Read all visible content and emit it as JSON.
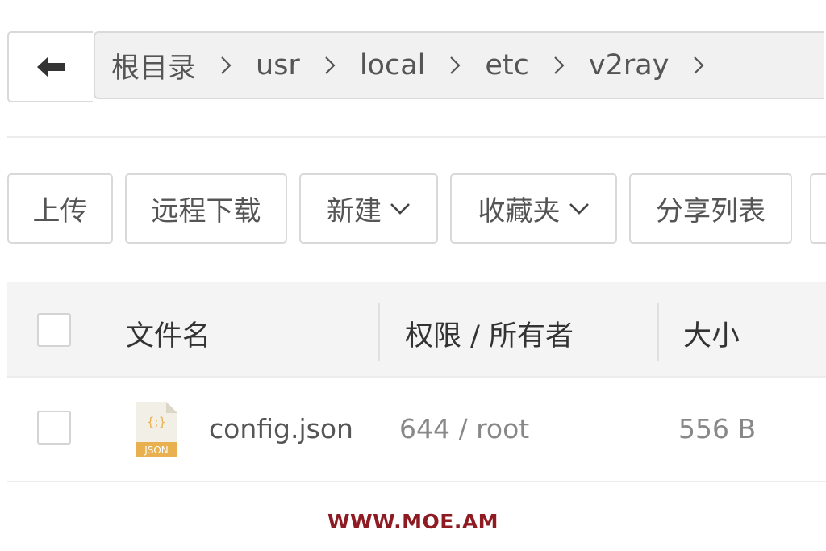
{
  "navigation": {
    "back_icon": "arrow-left-icon",
    "breadcrumb": [
      {
        "label": "根目录"
      },
      {
        "label": "usr"
      },
      {
        "label": "local"
      },
      {
        "label": "etc"
      },
      {
        "label": "v2ray"
      }
    ],
    "separator_icon": "chevron-right-icon"
  },
  "toolbar": {
    "upload": "上传",
    "remote_download": "远程下载",
    "new": "新建",
    "favorites": "收藏夹",
    "share_list": "分享列表",
    "dropdown_icon": "chevron-down-icon"
  },
  "table": {
    "columns": {
      "name": "文件名",
      "permission_owner": "权限 / 所有者",
      "size": "大小"
    },
    "rows": [
      {
        "name": "config.json",
        "icon": "json-file-icon",
        "icon_label": "JSON",
        "icon_glyph": "{;}",
        "permission": "644 / root",
        "size": "556 B"
      }
    ]
  },
  "watermark": "WWW.MOE.AM",
  "colors": {
    "border": "#d9d9d9",
    "breadcrumb_bg": "#f1f1f1",
    "header_bg": "#f4f4f4",
    "json_icon_accent": "#e8b04f",
    "watermark": "#8e1b22"
  }
}
